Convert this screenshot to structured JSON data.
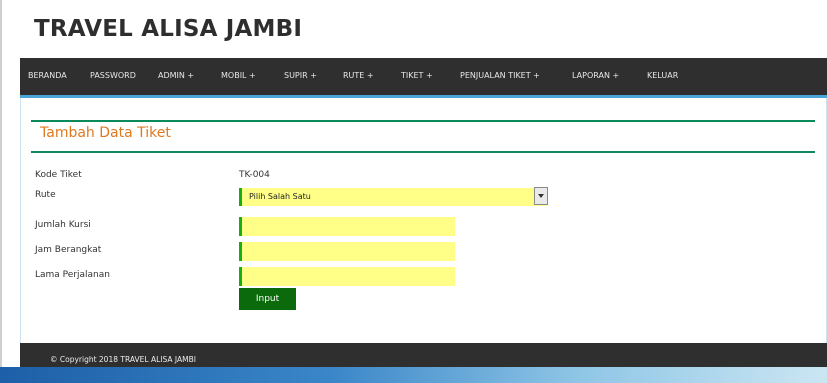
{
  "site": {
    "title": "TRAVEL ALISA JAMBI"
  },
  "nav": {
    "items": [
      {
        "label": "BERANDA"
      },
      {
        "label": "PASSWORD"
      },
      {
        "label": "ADMIN +"
      },
      {
        "label": "MOBIL +"
      },
      {
        "label": "SUPIR +"
      },
      {
        "label": "RUTE +"
      },
      {
        "label": "TIKET +"
      },
      {
        "label": "PENJUALAN TIKET +"
      },
      {
        "label": "LAPORAN +"
      },
      {
        "label": "KELUAR"
      }
    ]
  },
  "form": {
    "title": "Tambah Data Tiket",
    "fields": {
      "kode": {
        "label": "Kode Tiket",
        "value": "TK-004"
      },
      "rute": {
        "label": "Rute",
        "selected": "Pilih Salah Satu"
      },
      "jumlah_kursi": {
        "label": "Jumlah Kursi",
        "value": ""
      },
      "jam_berangkat": {
        "label": "Jam Berangkat",
        "value": ""
      },
      "lama_perjalanan": {
        "label": "Lama Perjalanan",
        "value": ""
      }
    },
    "submit_label": "Input"
  },
  "footer": {
    "copyright": "© Copyright 2018 TRAVEL ALISA JAMBI"
  },
  "colors": {
    "navbar": "#2f2f2f",
    "title_orange": "#e0781f",
    "divider_green": "#0c8a5c",
    "input_yellow": "#ffff88",
    "input_accent": "#14b014",
    "button_green": "#0b6a0b",
    "strip_blue": "#4aa6d6"
  },
  "icons": {
    "select_arrow": "chevron-down-icon"
  }
}
